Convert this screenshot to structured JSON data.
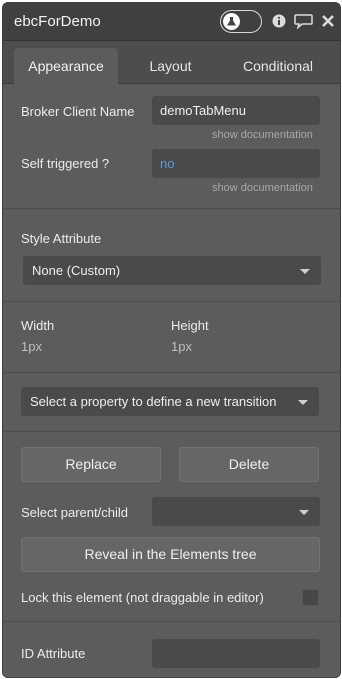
{
  "header": {
    "title": "ebcForDemo",
    "icons": [
      "user-badge-icon",
      "info-icon",
      "comment-icon",
      "close-icon"
    ]
  },
  "tabs": [
    {
      "label": "Appearance",
      "active": true
    },
    {
      "label": "Layout",
      "active": false
    },
    {
      "label": "Conditional",
      "active": false
    }
  ],
  "fields": {
    "broker_client_name": {
      "label": "Broker Client Name",
      "value": "demoTabMenu",
      "doc": "show documentation"
    },
    "self_triggered": {
      "label": "Self triggered ?",
      "value": "no",
      "doc": "show documentation"
    }
  },
  "style": {
    "label": "Style Attribute",
    "selected": "None (Custom)"
  },
  "size": {
    "width_label": "Width",
    "width_value": "1px",
    "height_label": "Height",
    "height_value": "1px"
  },
  "transition": {
    "placeholder": "Select a property to define a new transition"
  },
  "actions": {
    "replace": "Replace",
    "delete": "Delete"
  },
  "parent_child": {
    "label": "Select parent/child",
    "selected": ""
  },
  "reveal": {
    "label": "Reveal in the Elements tree"
  },
  "lock": {
    "label": "Lock this element (not draggable in editor)",
    "checked": false
  },
  "id_attribute": {
    "label": "ID Attribute",
    "value": ""
  },
  "colors": {
    "panel": "#5c5c5c",
    "titlebar": "#404040",
    "input": "#4a4a4a",
    "link": "#5b9bd5"
  }
}
